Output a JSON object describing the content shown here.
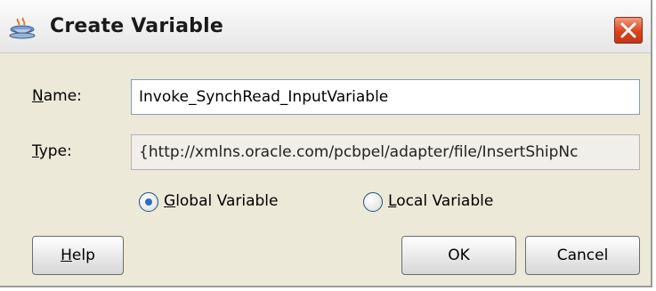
{
  "window": {
    "title": "Create Variable",
    "icon": "java-cup-icon",
    "close_icon": "close-icon"
  },
  "form": {
    "name": {
      "label_mnemonic": "N",
      "label_rest": "ame:",
      "value": "Invoke_SynchRead_InputVariable"
    },
    "type": {
      "label_mnemonic": "T",
      "label_rest": "ype:",
      "value": "{http://xmlns.oracle.com/pcbpel/adapter/file/InsertShipNc"
    },
    "scope": {
      "selected": "global",
      "options": [
        {
          "mnemonic": "G",
          "rest": "lobal Variable",
          "checked": true
        },
        {
          "mnemonic": "L",
          "rest": "ocal Variable",
          "checked": false
        }
      ]
    }
  },
  "buttons": {
    "help_mnemonic": "H",
    "help_rest": "elp",
    "ok": "OK",
    "cancel": "Cancel"
  }
}
